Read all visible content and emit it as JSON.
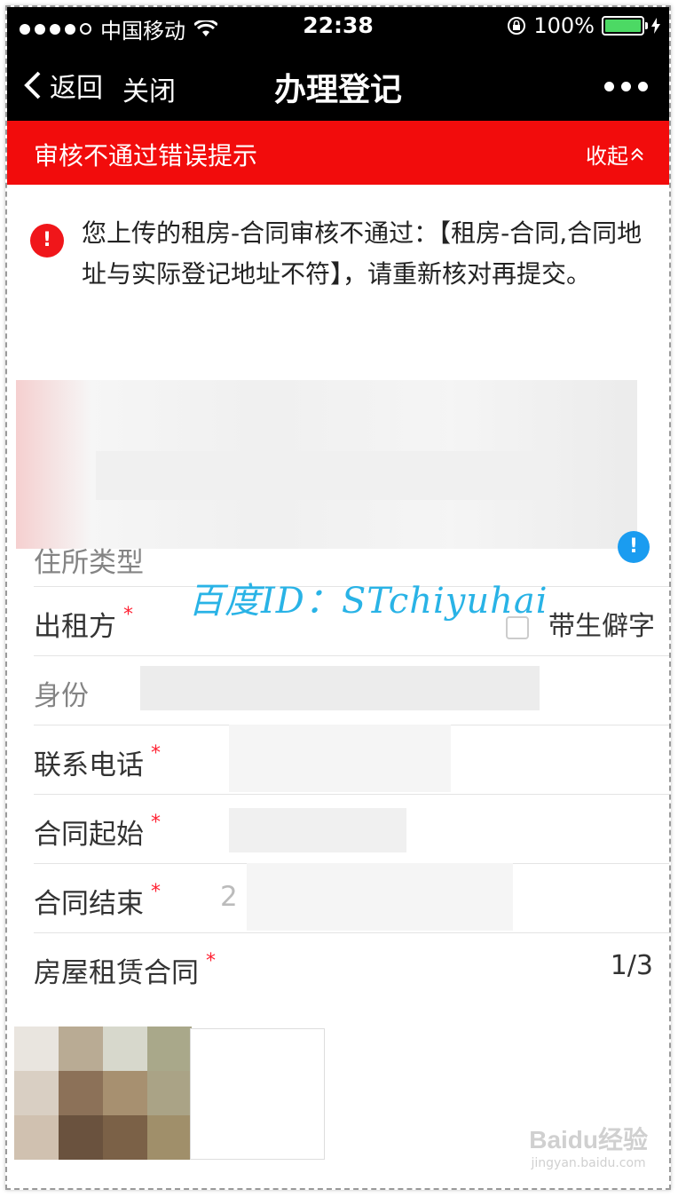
{
  "status": {
    "carrier": "中国移动",
    "time": "22:38",
    "battery": "100%",
    "battery_level": 1.0
  },
  "nav": {
    "back_label": "返回",
    "close_label": "关闭",
    "title": "办理登记"
  },
  "banner": {
    "title": "审核不通过错误提示",
    "collapse_label": "收起"
  },
  "message": {
    "icon_text": "!",
    "text": "您上传的租房-合同审核不通过：【租房-合同,合同地址与实际登记地址不符】，请重新核对再提交。"
  },
  "form": {
    "residence_type_label": "住所类型",
    "landlord_label": "出租方",
    "rare_char_label": "带生僻字",
    "id_label": "身份",
    "phone_label": "联系电话",
    "contract_start_label": "合同起始",
    "contract_end_label": "合同结束",
    "contract_end_value_prefix": "2",
    "lease_contract_label": "房屋租赁合同",
    "page_indicator": "1/3",
    "required_mark": "*"
  },
  "watermark": "百度ID：STchiyuhai",
  "baidu": {
    "logo": "Baidu经验",
    "domain": "jingyan.baidu.com"
  },
  "colors": {
    "bar_bg": "#000000",
    "banner_red": "#f20c0c",
    "accent_blue": "#1a9cf0",
    "required_red": "#ff2233"
  }
}
